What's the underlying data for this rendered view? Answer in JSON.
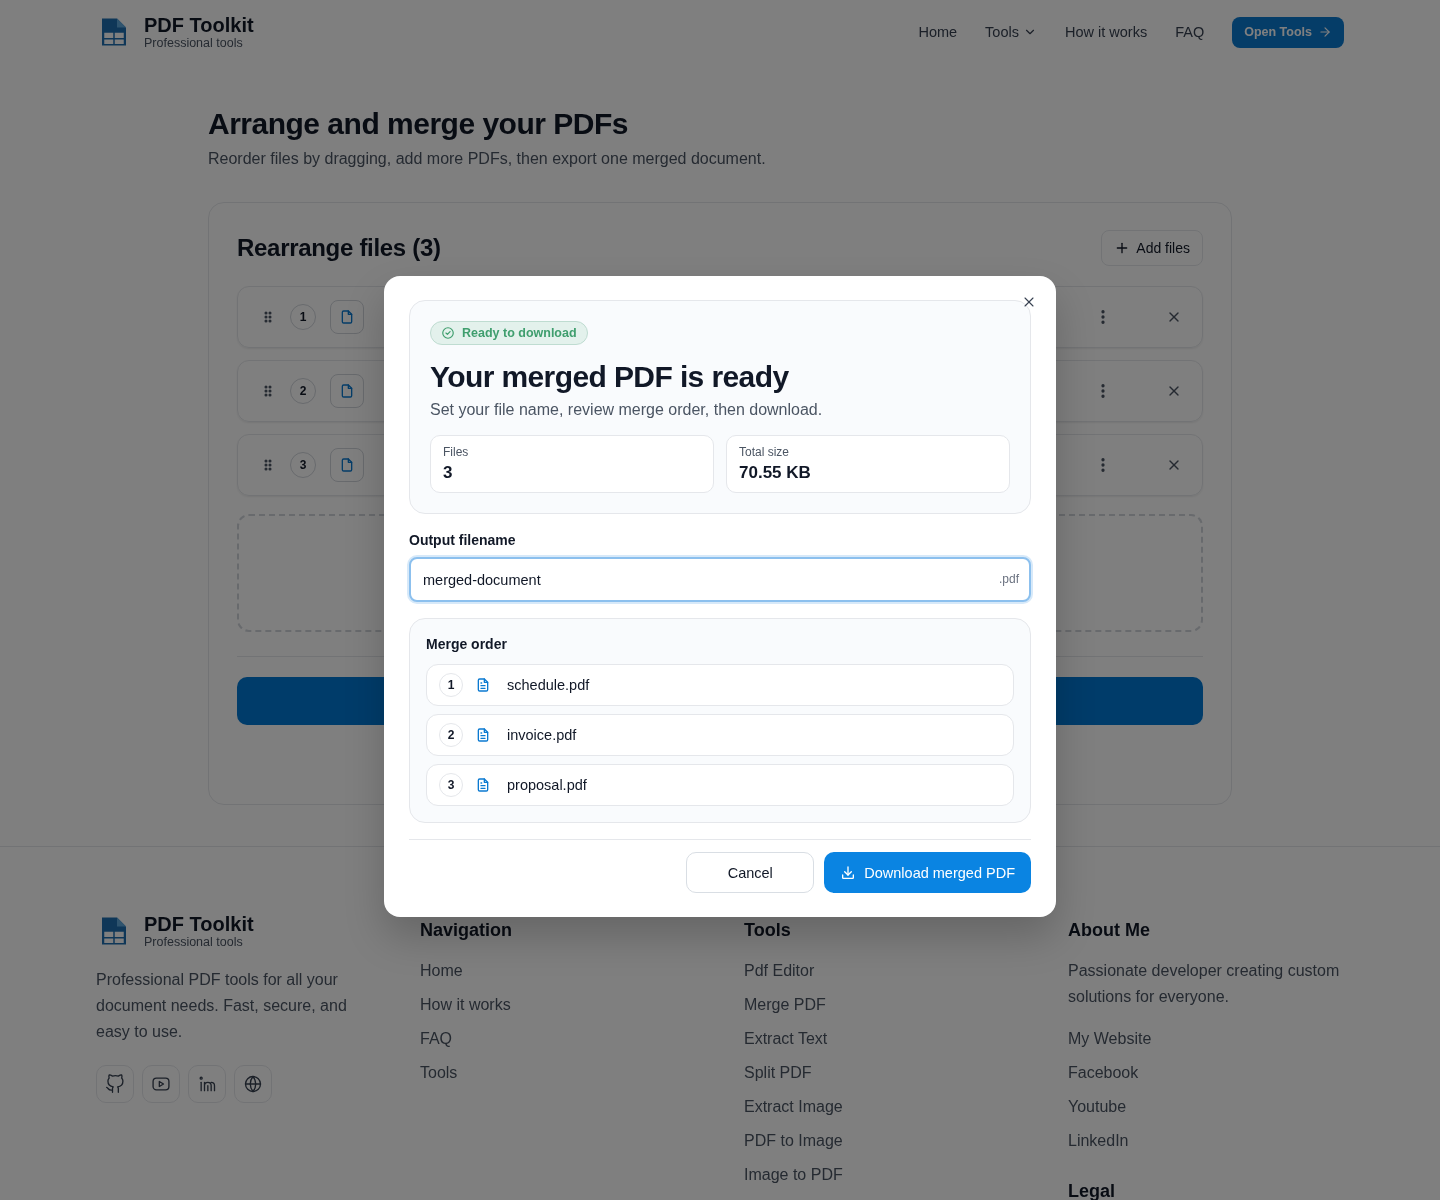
{
  "header": {
    "brand": "PDF Toolkit",
    "tagline": "Professional tools",
    "nav": [
      {
        "label": "Home",
        "kind": "link"
      },
      {
        "label": "Tools",
        "kind": "dropdown"
      },
      {
        "label": "How it works",
        "kind": "link"
      },
      {
        "label": "FAQ",
        "kind": "link"
      }
    ],
    "cta": "Open Tools"
  },
  "page": {
    "title": "Arrange and merge your PDFs",
    "subtitle": "Reorder files by dragging, add more PDFs, then export one merged document.",
    "card_title": "Rearrange files (3)",
    "add_button": "Add files",
    "files": [
      {
        "number": "1"
      },
      {
        "number": "2"
      },
      {
        "number": "3"
      }
    ]
  },
  "modal": {
    "badge": "Ready to download",
    "title": "Your merged PDF is ready",
    "subtitle": "Set your file name, review merge order, then download.",
    "stats": [
      {
        "label": "Files",
        "value": "3"
      },
      {
        "label": "Total size",
        "value": "70.55 KB"
      }
    ],
    "filename_label": "Output filename",
    "filename_value": "merged-document",
    "extension": ".pdf",
    "merge_order_title": "Merge order",
    "merge_order": [
      {
        "number": "1",
        "name": "schedule.pdf"
      },
      {
        "number": "2",
        "name": "invoice.pdf"
      },
      {
        "number": "3",
        "name": "proposal.pdf"
      }
    ],
    "cancel": "Cancel",
    "download": "Download merged PDF"
  },
  "footer": {
    "brand": "PDF Toolkit",
    "tagline": "Professional tools",
    "description": "Professional PDF tools for all your document needs. Fast, secure, and easy to use.",
    "social": [
      {
        "kind": "github"
      },
      {
        "kind": "youtube"
      },
      {
        "kind": "linkedin"
      },
      {
        "kind": "globe"
      }
    ],
    "columns": [
      {
        "title": "Navigation",
        "links": [
          "Home",
          "How it works",
          "FAQ",
          "Tools"
        ]
      },
      {
        "title": "Tools",
        "links": [
          "Pdf Editor",
          "Merge PDF",
          "Extract Text",
          "Split PDF",
          "Extract Image",
          "PDF to Image",
          "Image to PDF"
        ]
      },
      {
        "title": "About Me",
        "text": "Passionate developer creating custom solutions for everyone.",
        "links": [
          "My Website",
          "Facebook",
          "Youtube",
          "LinkedIn"
        ]
      },
      {
        "title": "Legal"
      }
    ]
  }
}
